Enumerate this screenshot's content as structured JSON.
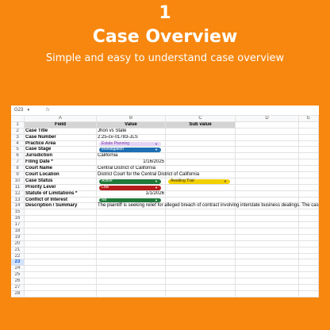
{
  "hero": {
    "number": "1",
    "title": "Case Overview",
    "subtitle": "Simple and easy to understand case overview"
  },
  "formula_bar": {
    "name_box": "G23",
    "fx": "fx"
  },
  "columns": [
    "A",
    "B",
    "C",
    "D",
    "E"
  ],
  "header": {
    "field": "Field",
    "value": "Value",
    "sub_value": "Sub value"
  },
  "rows": [
    {
      "n": "2",
      "field": "Case Title",
      "value": "Jhon vs State"
    },
    {
      "n": "3",
      "field": "Case Number",
      "value": "2:25-cv-01783-JLS"
    },
    {
      "n": "4",
      "field": "Practice Area",
      "value": "Estate Planning"
    },
    {
      "n": "5",
      "field": "Case Stage",
      "value": "Investigation"
    },
    {
      "n": "6",
      "field": "Jurisdiction",
      "value": "California"
    },
    {
      "n": "7",
      "field": "Filing Date *",
      "value": "1/16/2025"
    },
    {
      "n": "8",
      "field": "Court Name",
      "value": "Central District of California"
    },
    {
      "n": "9",
      "field": "Court Location",
      "value": "District Court for the Central District of California"
    },
    {
      "n": "10",
      "field": "Case Status",
      "value": "Active",
      "sub_value": "Awaiting Trial"
    },
    {
      "n": "11",
      "field": "Priority Level",
      "value": "Low"
    },
    {
      "n": "12",
      "field": "Statute of Limitations *",
      "value": "1/1/2026"
    },
    {
      "n": "13",
      "field": "Conflict of Interest",
      "value": "No"
    },
    {
      "n": "14",
      "field": "Description / Summary",
      "value": "The plaintiff is seeking relief for alleged breach of contract involving interstate business dealings. The case is current"
    }
  ],
  "empty_rows": [
    "15",
    "16",
    "17",
    "18",
    "19",
    "20",
    "21",
    "22",
    "23",
    "24",
    "25",
    "26",
    "27",
    "28",
    "29"
  ],
  "selected_row": "23",
  "colors": {
    "background": "#f7870f",
    "chip_purple": "#e6d4f4",
    "chip_blue": "#1f6fb5",
    "chip_green": "#1f7a3a",
    "chip_red": "#b71c1c",
    "chip_yellow": "#f3d000"
  }
}
